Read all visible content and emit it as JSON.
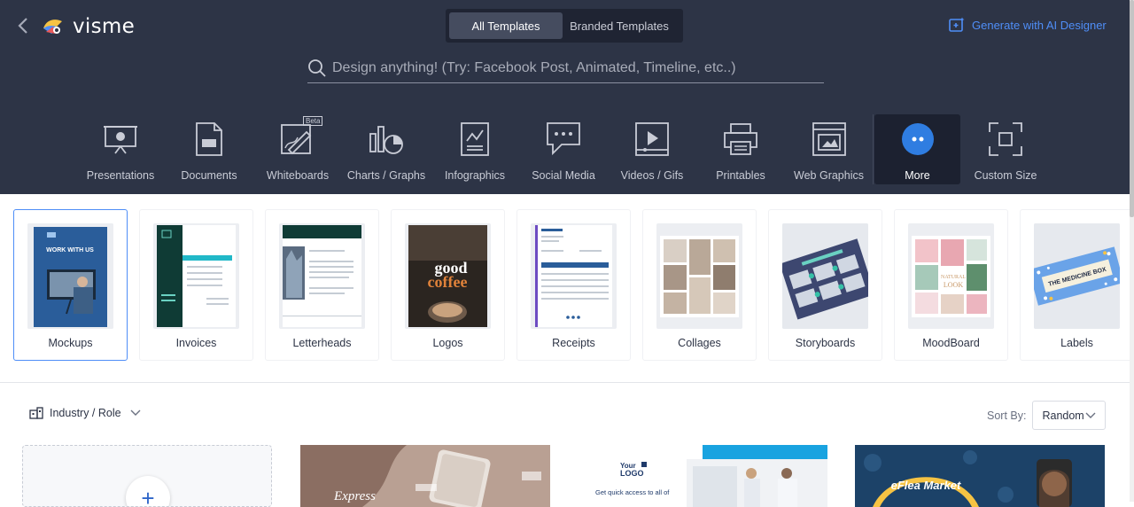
{
  "app": {
    "name": "visme"
  },
  "tabs": [
    {
      "label": "All Templates"
    },
    {
      "label": "Branded Templates"
    }
  ],
  "ai": {
    "label": "Generate with AI Designer"
  },
  "search": {
    "placeholder": "Design anything! (Try: Facebook Post, Animated, Timeline, etc..)"
  },
  "categories": [
    {
      "label": "Presentations",
      "icon": "presentation-icon"
    },
    {
      "label": "Documents",
      "icon": "document-icon"
    },
    {
      "label": "Whiteboards",
      "icon": "whiteboard-icon",
      "badge": "Beta"
    },
    {
      "label": "Charts / Graphs",
      "icon": "chart-icon"
    },
    {
      "label": "Infographics",
      "icon": "infographic-icon"
    },
    {
      "label": "Social Media",
      "icon": "social-media-icon"
    },
    {
      "label": "Videos / Gifs",
      "icon": "video-icon"
    },
    {
      "label": "Printables",
      "icon": "printer-icon"
    },
    {
      "label": "Web Graphics",
      "icon": "web-graphics-icon"
    },
    {
      "label": "More",
      "icon": "more-icon"
    },
    {
      "label": "Custom Size",
      "icon": "custom-size-icon"
    }
  ],
  "subcategories": [
    {
      "label": "Mockups",
      "thumb_text": "WORK WITH US"
    },
    {
      "label": "Invoices"
    },
    {
      "label": "Letterheads"
    },
    {
      "label": "Logos",
      "thumb_text": "good coffee"
    },
    {
      "label": "Receipts"
    },
    {
      "label": "Collages"
    },
    {
      "label": "Storyboards"
    },
    {
      "label": "MoodBoard",
      "thumb_text": "NATURAL LOOK"
    },
    {
      "label": "Labels",
      "thumb_text": "THE MEDICINE BOX"
    }
  ],
  "filter": {
    "label": "Industry / Role"
  },
  "sort": {
    "label": "Sort By:",
    "value": "Random"
  },
  "templates": [
    {
      "text": "Express"
    },
    {
      "text": "Get quick access to all of"
    },
    {
      "text": "eFlea Market"
    }
  ],
  "colors": {
    "header": "#2d3446",
    "accent": "#4f8ef7",
    "more_dot": "#2f7de1"
  }
}
